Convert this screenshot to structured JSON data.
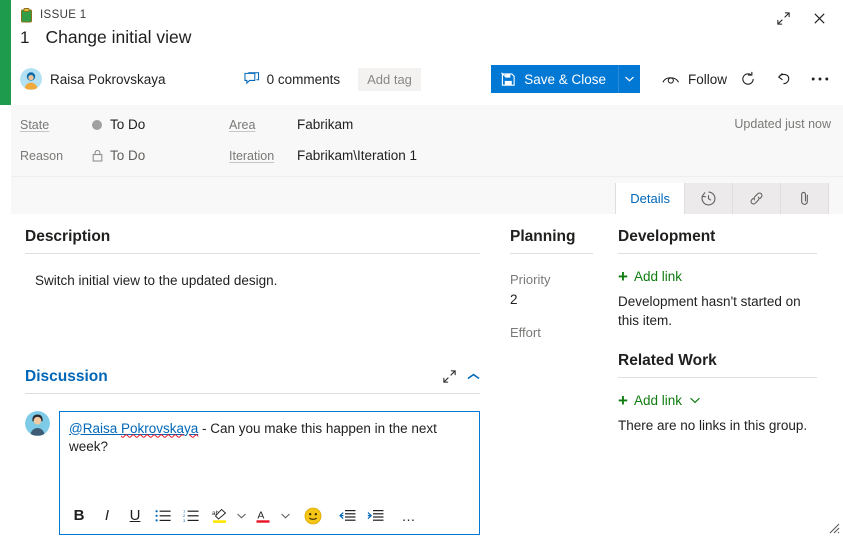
{
  "window": {
    "accent_color": "#1f9b4e",
    "expand_tooltip": "Expand",
    "close_tooltip": "Close"
  },
  "header": {
    "type_label": "ISSUE 1",
    "work_item_id": "1",
    "title": "Change initial view"
  },
  "toolbar": {
    "assignee": "Raisa Pokrovskaya",
    "comments": "0 comments",
    "add_tag": "Add tag",
    "save_close": "Save & Close",
    "follow": "Follow",
    "refresh_tooltip": "Refresh",
    "revert_tooltip": "Revert",
    "more_tooltip": "More actions"
  },
  "fields": {
    "state_label": "State",
    "state_value": "To Do",
    "reason_label": "Reason",
    "reason_value": "To Do",
    "area_label": "Area",
    "area_value": "Fabrikam",
    "iteration_label": "Iteration",
    "iteration_value": "Fabrikam\\Iteration 1",
    "updated": "Updated just now"
  },
  "tabs": [
    {
      "label": "Details",
      "icon": "details-text",
      "active": true
    },
    {
      "label": "",
      "icon": "history-icon",
      "active": false
    },
    {
      "label": "",
      "icon": "links-icon",
      "active": false
    },
    {
      "label": "",
      "icon": "attachments-icon",
      "active": false
    }
  ],
  "description": {
    "heading": "Description",
    "text": "Switch initial view to the updated design."
  },
  "discussion": {
    "heading": "Discussion",
    "mention": "@Raisa Pokrovskaya",
    "comment_rest": " - Can you make this happen in the next week?",
    "toolbar": {
      "bold": "B",
      "italic": "I",
      "underline": "U",
      "bullet_list": "bullet-list",
      "numbered_list": "numbered-list",
      "highlight": "highlight",
      "font_color": "A",
      "emoji": "emoji",
      "outdent": "outdent",
      "indent": "indent",
      "more": "…"
    }
  },
  "planning": {
    "heading": "Planning",
    "priority_label": "Priority",
    "priority_value": "2",
    "effort_label": "Effort",
    "effort_value": ""
  },
  "development": {
    "heading": "Development",
    "add_link": "Add link",
    "note": "Development hasn't started on this item."
  },
  "related_work": {
    "heading": "Related Work",
    "add_link": "Add link",
    "note": "There are no links in this group."
  },
  "colors": {
    "primary_blue": "#0078d4",
    "link_blue": "#0067b8",
    "green": "#107c10",
    "accent_green": "#1f9b4e"
  }
}
